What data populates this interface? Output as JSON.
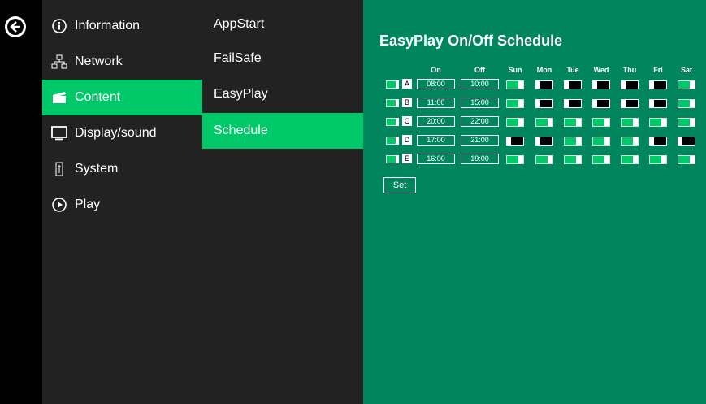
{
  "sidebar": {
    "items": [
      {
        "label": "Information",
        "icon": "info-icon"
      },
      {
        "label": "Network",
        "icon": "network-icon"
      },
      {
        "label": "Content",
        "icon": "clapperboard-icon",
        "active": true
      },
      {
        "label": "Display/sound",
        "icon": "monitor-icon"
      },
      {
        "label": "System",
        "icon": "system-icon"
      },
      {
        "label": "Play",
        "icon": "play-icon"
      }
    ]
  },
  "submenu": {
    "items": [
      {
        "label": "AppStart"
      },
      {
        "label": "FailSafe"
      },
      {
        "label": "EasyPlay"
      },
      {
        "label": "Schedule",
        "active": true
      }
    ]
  },
  "schedule": {
    "title": "EasyPlay On/Off Schedule",
    "headers": {
      "on": "On",
      "off": "Off",
      "days": [
        "Sun",
        "Mon",
        "Tue",
        "Wed",
        "Thu",
        "Fri",
        "Sat"
      ]
    },
    "rows": [
      {
        "label": "A",
        "enabled": true,
        "on": "08:00",
        "off": "10:00",
        "days": [
          true,
          false,
          false,
          false,
          false,
          false,
          true
        ]
      },
      {
        "label": "B",
        "enabled": true,
        "on": "11:00",
        "off": "15:00",
        "days": [
          true,
          false,
          false,
          false,
          false,
          false,
          true
        ]
      },
      {
        "label": "C",
        "enabled": true,
        "on": "20:00",
        "off": "22:00",
        "days": [
          true,
          true,
          true,
          true,
          true,
          true,
          true
        ]
      },
      {
        "label": "D",
        "enabled": true,
        "on": "17:00",
        "off": "21:00",
        "days": [
          false,
          false,
          true,
          true,
          true,
          false,
          false
        ]
      },
      {
        "label": "E",
        "enabled": true,
        "on": "16:00",
        "off": "19:00",
        "days": [
          true,
          true,
          true,
          true,
          true,
          true,
          true
        ]
      }
    ],
    "set_label": "Set"
  },
  "colors": {
    "accent": "#00c96a",
    "panel": "#00855c",
    "menu": "#222222"
  }
}
